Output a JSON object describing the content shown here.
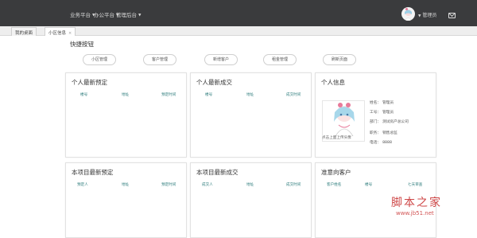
{
  "topbar": {
    "menus": [
      {
        "label": "业务平台"
      },
      {
        "label": "办公平台"
      },
      {
        "label": "管理后台"
      }
    ],
    "user": "管理员"
  },
  "tabs": [
    {
      "label": "我的桌面"
    },
    {
      "label": "小区信息",
      "close": "×"
    }
  ],
  "quick": {
    "title": "快捷按钮",
    "buttons": [
      "小区管理",
      "客户管理",
      "新增客户",
      "租金管理",
      "刷新页面"
    ]
  },
  "panels": {
    "personal_booking": {
      "title": "个人最新预定",
      "cols": [
        "楼号",
        "地址",
        "预定时间"
      ]
    },
    "personal_deal": {
      "title": "个人最新成交",
      "cols": [
        "楼号",
        "地址",
        "成交时间"
      ]
    },
    "personal_info": {
      "title": "个人信息",
      "photo_caption": "点击上面上传头像",
      "rows": [
        {
          "label": "姓名：",
          "value": "管理员"
        },
        {
          "label": "工号：",
          "value": "管理员"
        },
        {
          "label": "部门：",
          "value": "测试房产总公司"
        },
        {
          "label": "职务：",
          "value": "销售总监"
        },
        {
          "label": "电话：",
          "value": "8888"
        }
      ]
    },
    "project_booking": {
      "title": "本项目最新预定",
      "cols": [
        "预定人",
        "地址",
        "预定时间"
      ]
    },
    "project_deal": {
      "title": "本项目最新成交",
      "cols": [
        "成交人",
        "地址",
        "成交时间"
      ]
    },
    "prospects": {
      "title": "准意向客户",
      "cols": [
        "客户姓名",
        "楼号",
        "七天审查"
      ]
    }
  },
  "watermark": {
    "text": "脚本之家",
    "url": "www.jb51.net"
  }
}
